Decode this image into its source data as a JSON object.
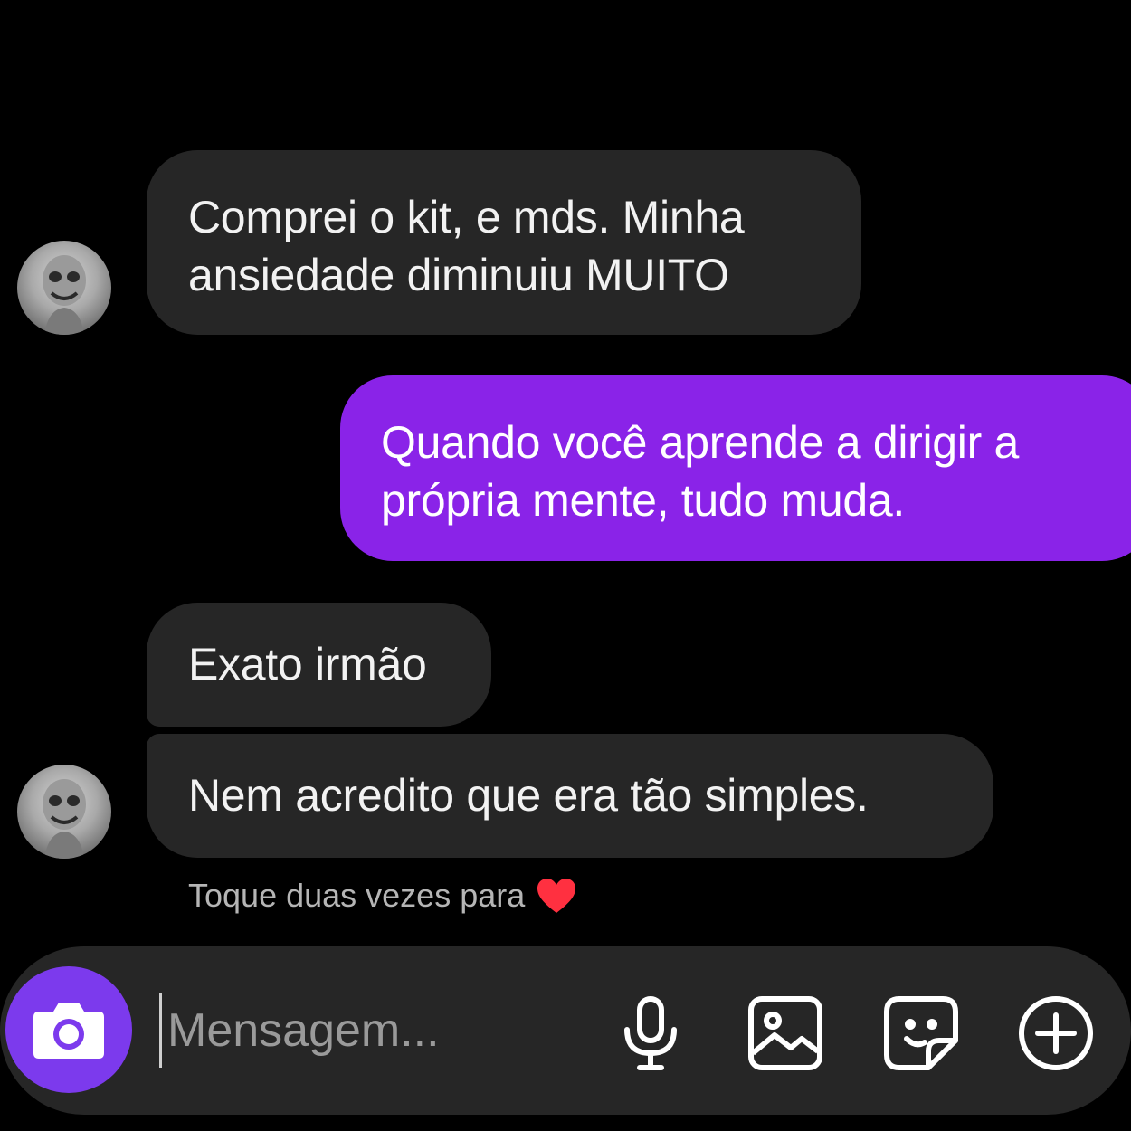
{
  "thread": {
    "messages": [
      {
        "sender": "them",
        "text_lines": [
          "Comprei o kit, e mds. Minha",
          "ansiedade diminuiu MUITO"
        ]
      },
      {
        "sender": "me",
        "text_lines": [
          "Quando você aprende a dirigir a",
          "própria mente, tudo muda."
        ]
      },
      {
        "sender": "them",
        "text_lines": [
          "Exato irmão"
        ]
      },
      {
        "sender": "them",
        "text_lines": [
          "Nem acredito que era tão simples."
        ]
      }
    ],
    "reaction_hint": "Toque duas vezes para",
    "reaction_icon": "heart-icon",
    "avatar_icon": "contact-avatar"
  },
  "composer": {
    "placeholder": "Mensagem...",
    "value": "",
    "icons": {
      "camera": "camera-icon",
      "mic": "microphone-icon",
      "gallery": "image-icon",
      "sticker": "sticker-icon",
      "plus": "plus-circle-icon"
    }
  },
  "colors": {
    "background": "#000000",
    "incoming_bubble": "#262626",
    "outgoing_bubble": "#8a23e8",
    "camera_button": "#7c3aed",
    "composer_bar": "#262626",
    "heart": "#ff3040"
  }
}
